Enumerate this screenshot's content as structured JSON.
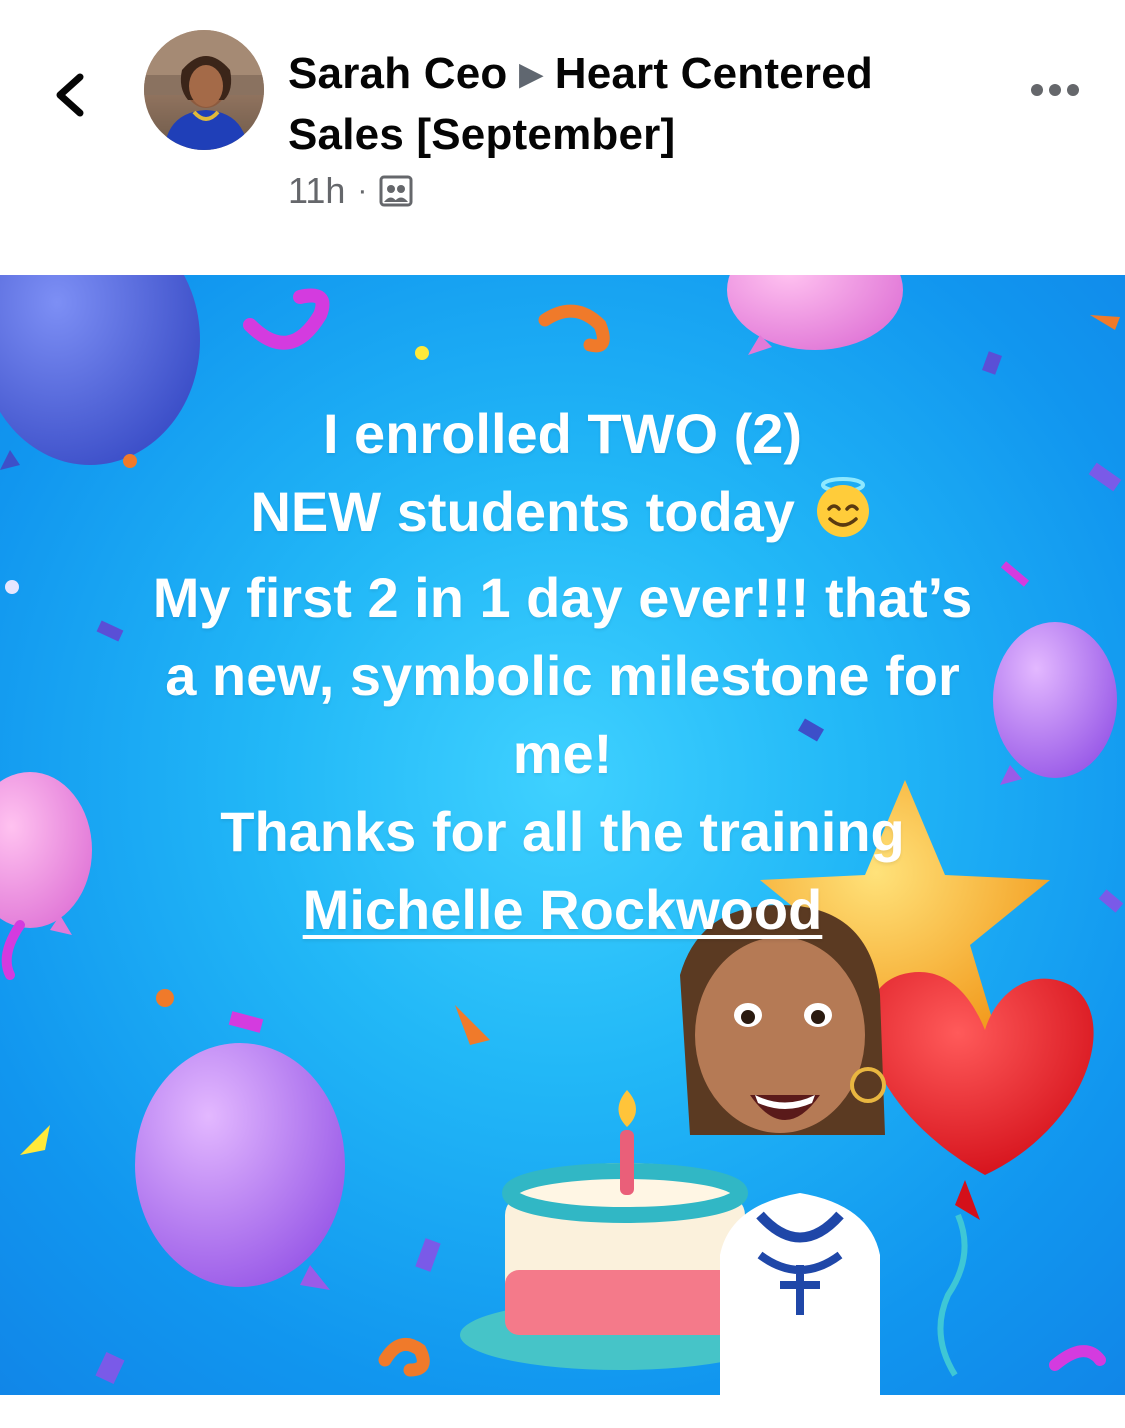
{
  "post": {
    "author": "Sarah Ceo",
    "group": "Heart Centered Sales [September]",
    "group_line1": "Heart Centered",
    "group_line2": "Sales [September]",
    "time": "11h",
    "audience_icon": "group-members-icon"
  },
  "image_text": {
    "line1": "I enrolled TWO (2)",
    "line2": "NEW students today",
    "line2_emoji": "smiling-face-with-halo",
    "line3": "My first 2 in 1 day ever!!! that’s",
    "line4": "a new, symbolic milestone for",
    "line5": "me!",
    "line6": "Thanks for all the training",
    "mention": "Michelle Rockwood"
  },
  "icons": {
    "back": "chevron-left-icon",
    "more": "more-options-icon"
  },
  "colors": {
    "background_blue": "#1ea7f3",
    "text_primary": "#050505",
    "text_secondary": "#65676b",
    "overlay_text": "#ffffff"
  }
}
